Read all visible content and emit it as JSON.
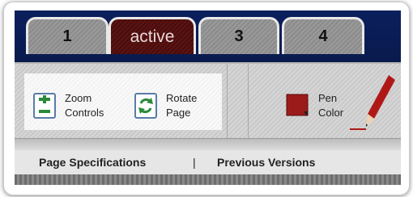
{
  "tabs": [
    {
      "label": "1"
    },
    {
      "label": "active"
    },
    {
      "label": "3"
    },
    {
      "label": "4"
    }
  ],
  "toolbar": {
    "zoom": {
      "label": "Zoom\nControls",
      "icon": "zoom-plus-minus-icon"
    },
    "rotate": {
      "label": "Rotate\nPage",
      "icon": "rotate-arrows-icon"
    },
    "pen_color": {
      "label": "Pen\nColor",
      "icon": "pen-icon",
      "swatch_color": "#9b1b1b"
    }
  },
  "subnav": {
    "page_specifications": "Page Specifications",
    "divider": "|",
    "previous_versions": "Previous Versions"
  },
  "colors": {
    "tab_bar_bg": "#0b1f5e",
    "active_tab": "#4a0c0c",
    "icon_accent": "#2a8a3a",
    "pen_red": "#b01818"
  }
}
